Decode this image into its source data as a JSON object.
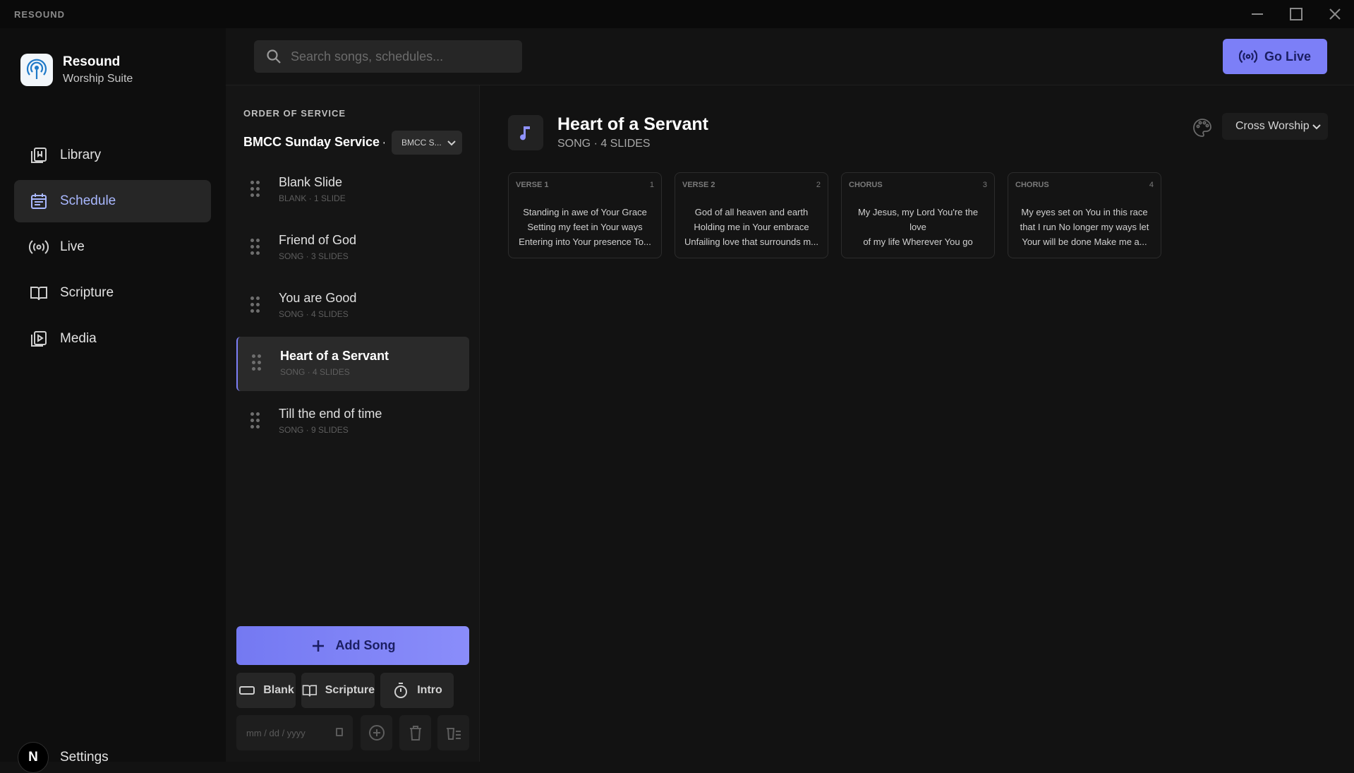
{
  "window": {
    "title": "RESOUND"
  },
  "brand": {
    "name": "Resound",
    "subtitle": "Worship Suite"
  },
  "nav": [
    {
      "label": "Library",
      "icon": "library-icon"
    },
    {
      "label": "Schedule",
      "icon": "calendar-icon",
      "active": true
    },
    {
      "label": "Live",
      "icon": "broadcast-icon"
    },
    {
      "label": "Scripture",
      "icon": "book-icon"
    },
    {
      "label": "Media",
      "icon": "media-icon"
    }
  ],
  "settings": {
    "avatar_letter": "N",
    "label": "Settings"
  },
  "search": {
    "placeholder": "Search songs, schedules..."
  },
  "go_live": {
    "label": "Go Live"
  },
  "order": {
    "heading": "ORDER OF SERVICE",
    "service_title": "BMCC Sunday Service -...",
    "service_select": "BMCC S...",
    "items": [
      {
        "title": "Blank Slide",
        "meta": "BLANK · 1 SLIDE"
      },
      {
        "title": "Friend of God",
        "meta": "SONG · 3 SLIDES"
      },
      {
        "title": "You are Good",
        "meta": "SONG · 4 SLIDES"
      },
      {
        "title": "Heart of a Servant",
        "meta": "SONG · 4 SLIDES",
        "active": true
      },
      {
        "title": "Till the end of time",
        "meta": "SONG · 9 SLIDES"
      }
    ],
    "add_song": "Add Song",
    "quick": {
      "blank": "Blank",
      "scripture": "Scripture",
      "intro": "Intro"
    },
    "date_placeholder": "mm / dd / yyyy"
  },
  "main": {
    "title": "Heart of a Servant",
    "meta": "SONG · 4 SLIDES",
    "theme": "Cross Worship",
    "slides": [
      {
        "label": "VERSE 1",
        "num": "1",
        "text": "Standing in awe of Your Grace\nSetting my feet in Your ways\nEntering into Your presence To..."
      },
      {
        "label": "VERSE 2",
        "num": "2",
        "text": "God of all heaven and earth\nHolding me in Your embrace\nUnfailing love that surrounds m..."
      },
      {
        "label": "CHORUS",
        "num": "3",
        "text": "My Jesus, my Lord You're the love\nof my life Wherever You go\nwanna be by your side No long..."
      },
      {
        "label": "CHORUS",
        "num": "4",
        "text": "My eyes set on You in this race\nthat I run No longer my ways let\nYour will be done Make me a..."
      }
    ]
  },
  "colors": {
    "accent": "#7c7ff7",
    "active_nav_text": "#a9b8ff"
  }
}
